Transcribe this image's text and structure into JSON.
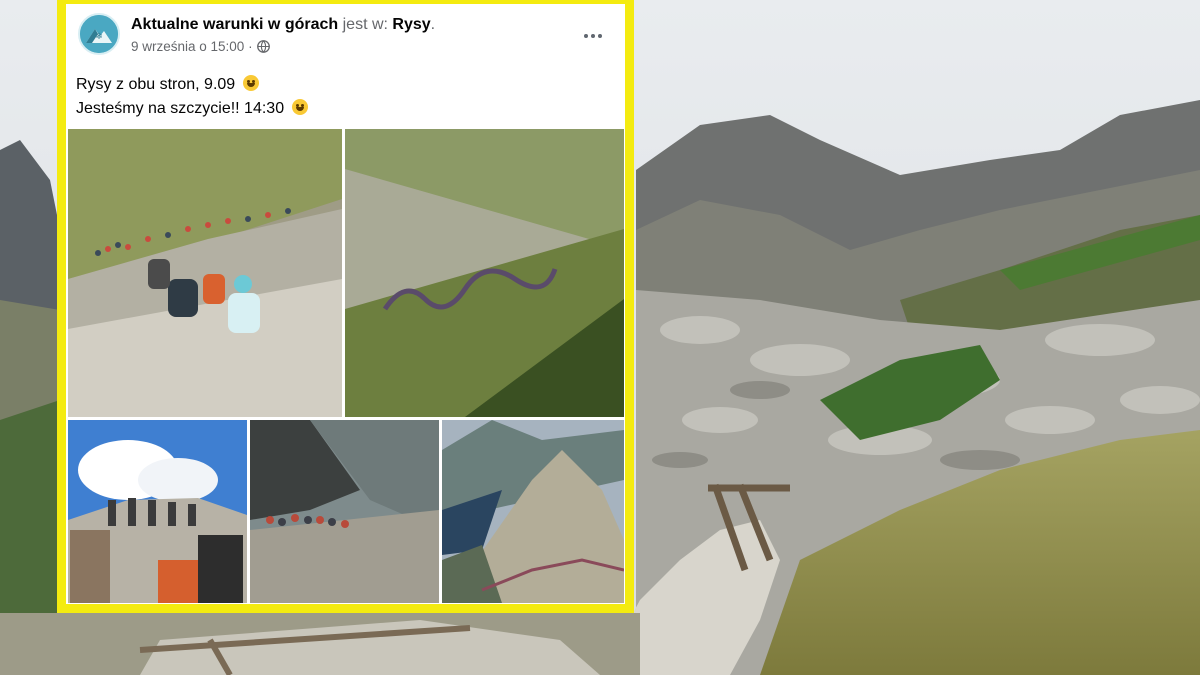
{
  "post": {
    "page_name": "Aktualne warunki w górach",
    "location_prefix": "jest w:",
    "location": "Rysy",
    "location_suffix": ".",
    "date": "9 września o 15:00 ·",
    "text_line1": "Rysy z obu stron, 9.09",
    "text_line2": "Jesteśmy na szczycie!! 14:30",
    "icons": [
      "globe-icon",
      "more-options-icon",
      "grinning-emoji-icon",
      "page-logo-icon"
    ],
    "photos": [
      "photo-hikers-climbing-chains",
      "photo-queue-on-slope",
      "photo-summit-crowd",
      "photo-ridge-hikers",
      "photo-ridge-lake-view"
    ]
  },
  "colors": {
    "highlight_frame": "#f4eb10",
    "logo": "#4aa8c2"
  }
}
